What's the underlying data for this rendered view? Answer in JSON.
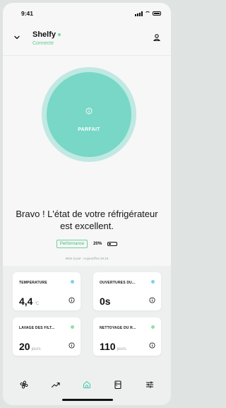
{
  "status_bar": {
    "time": "9:41"
  },
  "header": {
    "title": "Shelfy",
    "subtitle": "Connecte"
  },
  "status_circle": {
    "label": "PARFAIT",
    "color": "#78d7c7",
    "ring_color": "#bfe9e2"
  },
  "message": "Bravo ! L'état de votre réfrigérateur est excellent.",
  "performance": {
    "label": "Performance",
    "percent": "20%"
  },
  "last_update": "Mise à jour : Aujourd'hui 18:16",
  "cards": [
    {
      "label": "TEMPERATURE",
      "value": "4,4",
      "unit": "°C",
      "dot_color": "#7fd0e6"
    },
    {
      "label": "OUVERTURES DU...",
      "value": "0s",
      "unit": "",
      "dot_color": "#7fd0e6"
    },
    {
      "label": "LAVAGE DES FILT...",
      "value": "20",
      "unit": "jours",
      "dot_color": "#8ee0a8"
    },
    {
      "label": "NETTOYAGE DU R...",
      "value": "110",
      "unit": "jours",
      "dot_color": "#8ee0a8"
    }
  ],
  "tabs": [
    {
      "name": "fan-icon"
    },
    {
      "name": "trend-icon"
    },
    {
      "name": "home-icon",
      "active": true
    },
    {
      "name": "fridge-icon"
    },
    {
      "name": "settings-sliders-icon"
    }
  ],
  "colors": {
    "accent": "#63c98f",
    "active_tab": "#4fc9b5"
  }
}
